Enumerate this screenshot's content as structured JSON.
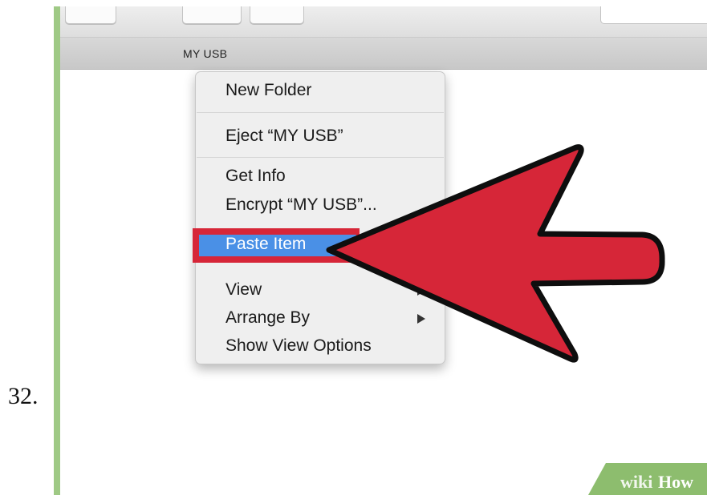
{
  "step": {
    "number": "32."
  },
  "finder": {
    "path_title": "MY USB"
  },
  "context_menu": {
    "items": [
      {
        "label": "New Folder"
      },
      {
        "label": "Eject “MY USB”"
      },
      {
        "label": "Get Info"
      },
      {
        "label": "Encrypt “MY USB”..."
      },
      {
        "label": "Paste Item",
        "highlighted": true
      },
      {
        "label": "View"
      },
      {
        "label": "Arrange By"
      },
      {
        "label": "Show View Options"
      }
    ]
  },
  "annotation": {
    "arrow_color": "#d62638",
    "highlight_box_color": "#d62638",
    "icon": "pointer-arrow-icon"
  },
  "watermark": {
    "part1": "wiki",
    "part2": "How"
  },
  "colors": {
    "frame": "#9fc985",
    "selection": "#4a90e6"
  }
}
